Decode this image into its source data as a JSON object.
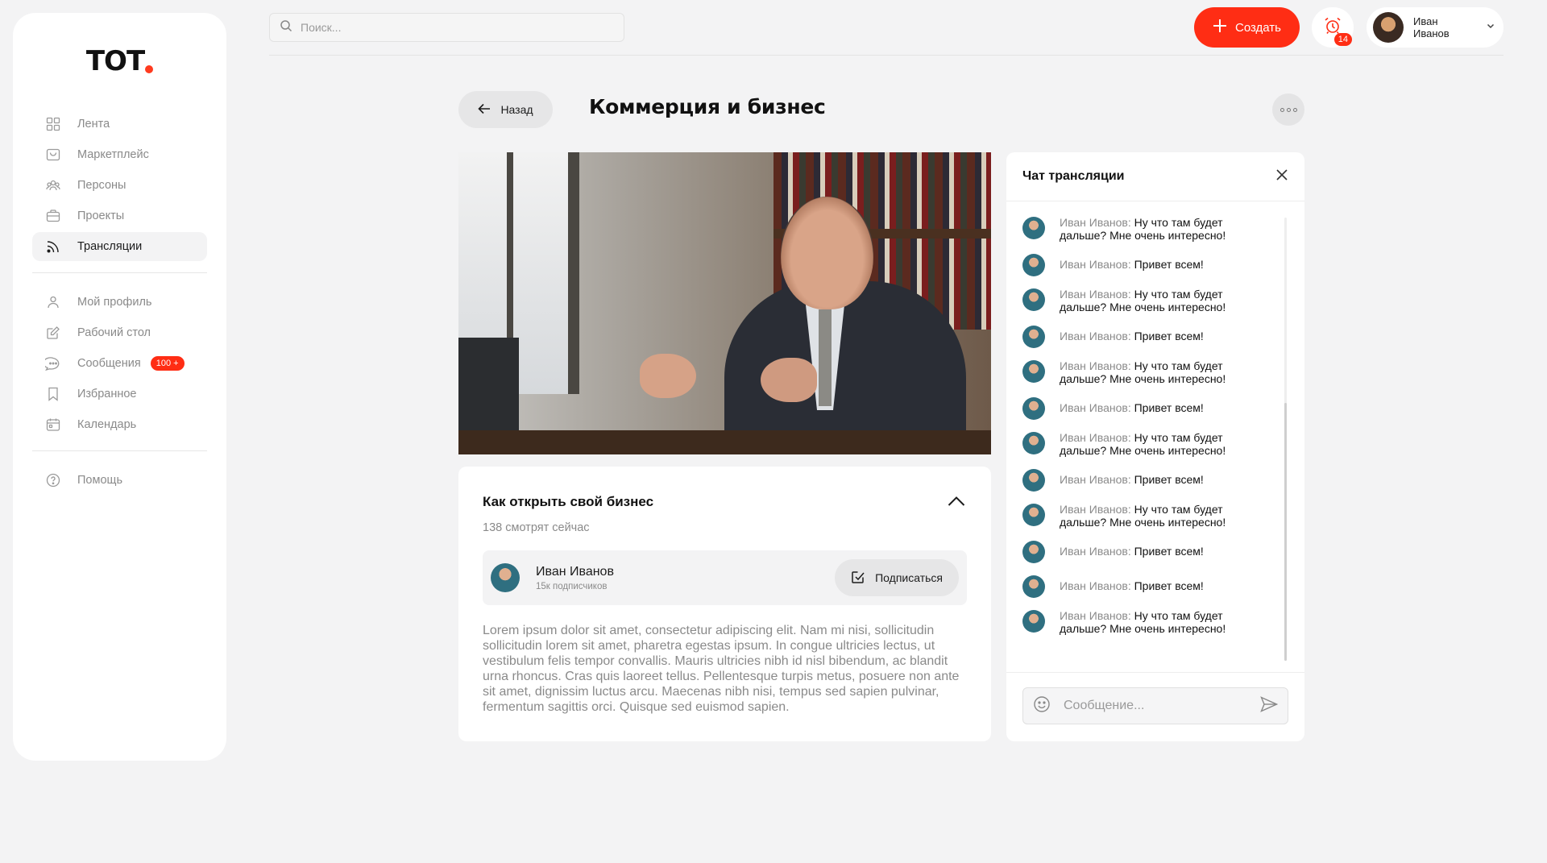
{
  "logo": {
    "text": "TOT"
  },
  "sidebar": {
    "items": [
      {
        "label": "Лента",
        "icon": "grid-icon",
        "active": false
      },
      {
        "label": "Маркетплейс",
        "icon": "bag-icon",
        "active": false
      },
      {
        "label": "Персоны",
        "icon": "people-icon",
        "active": false
      },
      {
        "label": "Проекты",
        "icon": "briefcase-icon",
        "active": false
      },
      {
        "label": "Трансляции",
        "icon": "broadcast-icon",
        "active": true
      }
    ],
    "items2": [
      {
        "label": "Мой профиль",
        "icon": "user-icon"
      },
      {
        "label": "Рабочий стол",
        "icon": "edit-icon"
      },
      {
        "label": "Сообщения",
        "icon": "chat-icon",
        "badge": "100 +"
      },
      {
        "label": "Избранное",
        "icon": "bookmark-icon"
      },
      {
        "label": "Календарь",
        "icon": "calendar-icon"
      }
    ],
    "items3": [
      {
        "label": "Помощь",
        "icon": "help-icon"
      }
    ]
  },
  "topbar": {
    "search_placeholder": "Поиск...",
    "create_label": "Создать",
    "notifications_count": "14",
    "user_name": "Иван Иванов"
  },
  "page": {
    "back_label": "Назад",
    "title": "Коммерция и бизнес"
  },
  "stream": {
    "title": "Как открыть свой бизнес",
    "viewers": "138 смотрят сейчас",
    "author_name": "Иван Иванов",
    "author_subs": "15к подписчиков",
    "subscribe_label": "Подписаться",
    "description": "Lorem ipsum dolor sit amet, consectetur adipiscing elit. Nam mi nisi, sollicitudin sollicitudin lorem sit amet, pharetra egestas ipsum. In congue ultricies lectus, ut vestibulum felis tempor convallis. Mauris ultricies nibh id nisl bibendum, ac blandit urna rhoncus. Cras quis laoreet tellus. Pellentesque turpis metus, posuere non ante sit amet, dignissim luctus arcu. Maecenas nibh nisi, tempus sed sapien pulvinar, fermentum sagittis orci. Quisque sed euismod sapien."
  },
  "chat": {
    "title": "Чат трансляции",
    "input_placeholder": "Сообщение...",
    "messages": [
      {
        "author": "Иван Иванов:",
        "text": " Ну что там будет дальше? Мне очень интересно!"
      },
      {
        "author": "Иван Иванов:",
        "text": " Привет всем!"
      },
      {
        "author": "Иван Иванов:",
        "text": " Ну что там будет дальше? Мне очень интересно!"
      },
      {
        "author": "Иван Иванов:",
        "text": " Привет всем!"
      },
      {
        "author": "Иван Иванов:",
        "text": " Ну что там будет дальше? Мне очень интересно!"
      },
      {
        "author": "Иван Иванов:",
        "text": " Привет всем!"
      },
      {
        "author": "Иван Иванов:",
        "text": " Ну что там будет дальше? Мне очень интересно!"
      },
      {
        "author": "Иван Иванов:",
        "text": " Привет всем!"
      },
      {
        "author": "Иван Иванов:",
        "text": " Ну что там будет дальше? Мне очень интересно!"
      },
      {
        "author": "Иван Иванов:",
        "text": " Привет всем!"
      },
      {
        "author": "Иван Иванов:",
        "text": " Привет всем!"
      },
      {
        "author": "Иван Иванов:",
        "text": " Ну что там будет дальше? Мне очень интересно!"
      }
    ]
  },
  "colors": {
    "accent": "#ff2d14",
    "background": "#f3f3f4",
    "muted": "#8a8a8a"
  }
}
